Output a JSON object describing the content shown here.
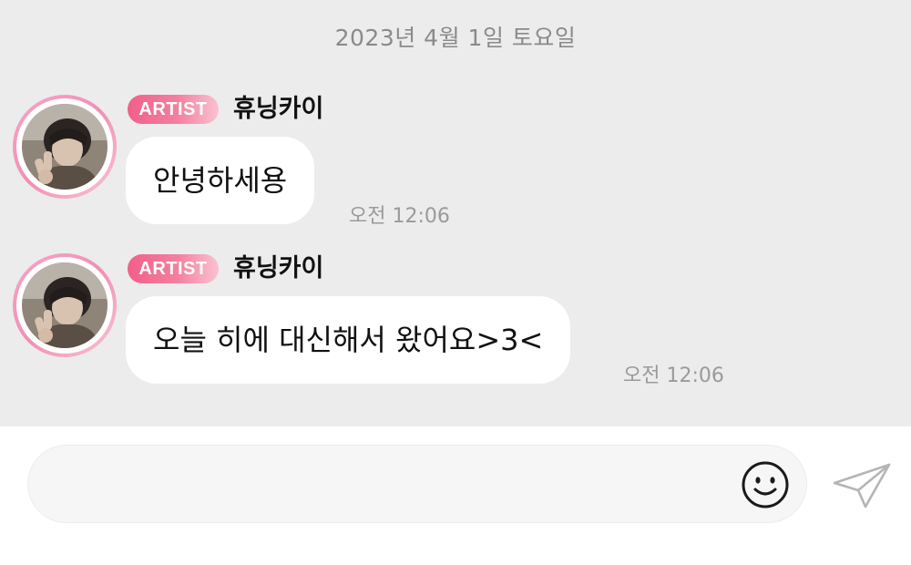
{
  "chat": {
    "date": "2023년 4월 1일 토요일",
    "messages": [
      {
        "badge": "ARTIST",
        "sender": "휴닝카이",
        "text": "안녕하세용",
        "time": "오전 12:06"
      },
      {
        "badge": "ARTIST",
        "sender": "휴닝카이",
        "text": "오늘 히에 대신해서 왔어요>3<",
        "time": "오전 12:06"
      }
    ]
  },
  "composer": {
    "placeholder": "",
    "emoji_icon": "smiley-icon",
    "send_icon": "paper-plane-icon"
  },
  "colors": {
    "chat_background": "#ececec",
    "badge_pink": "#f0608a",
    "avatar_ring": "#f28fb3",
    "bubble": "#ffffff",
    "timestamp": "#9a9a9a"
  }
}
